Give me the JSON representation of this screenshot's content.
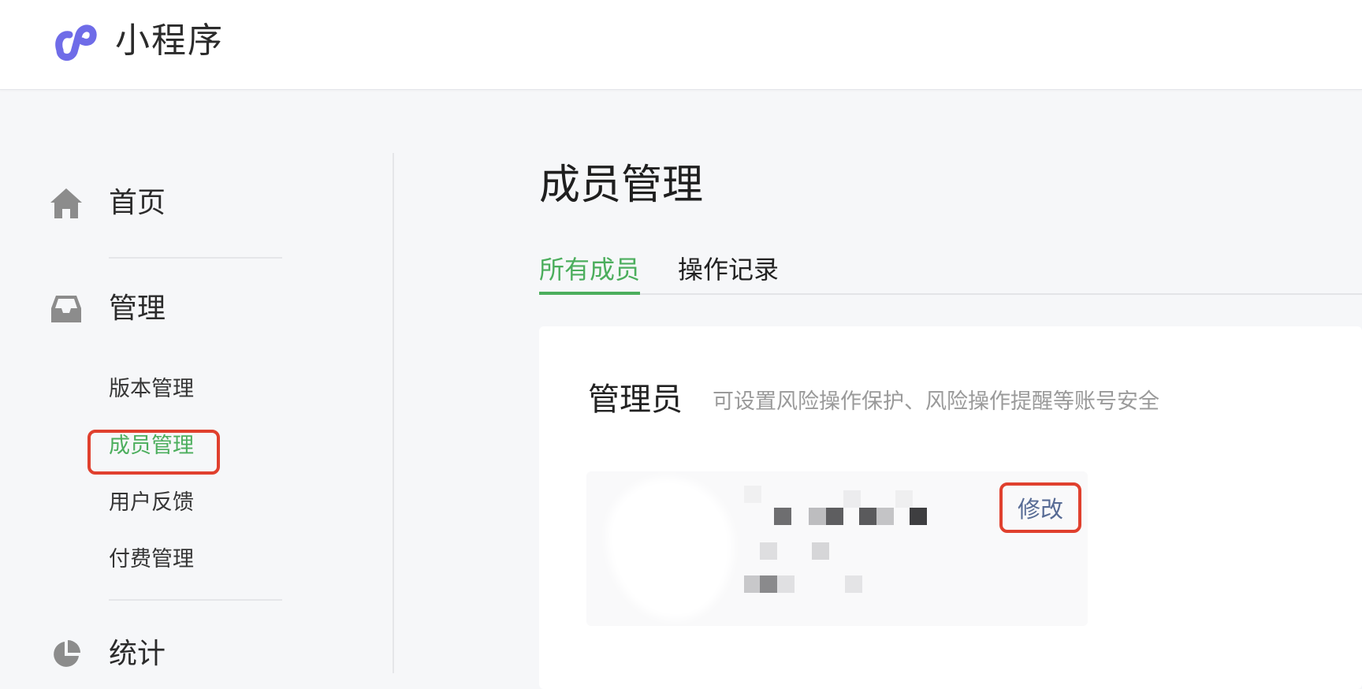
{
  "header": {
    "app_name": "小程序",
    "logo_icon": "mini-program-logo-icon",
    "logo_color": "#6f6ce8"
  },
  "sidebar": {
    "sections": [
      {
        "label": "首页",
        "icon": "home-icon"
      },
      {
        "label": "管理",
        "icon": "inbox-icon"
      },
      {
        "label": "统计",
        "icon": "pie-chart-icon"
      }
    ],
    "sub_items": [
      {
        "label": "版本管理",
        "active": false
      },
      {
        "label": "成员管理",
        "active": true
      },
      {
        "label": "用户反馈",
        "active": false
      },
      {
        "label": "付费管理",
        "active": false
      }
    ]
  },
  "main": {
    "page_title": "成员管理",
    "tabs": [
      {
        "label": "所有成员",
        "active": true
      },
      {
        "label": "操作记录",
        "active": false
      }
    ],
    "admin_section": {
      "title": "管理员",
      "description": "可设置风险操作保护、风险操作提醒等账号安全",
      "modify_label": "修改"
    }
  },
  "colors": {
    "accent_green": "#4cae5d",
    "link_blue": "#576b95",
    "highlight_red": "#e0402e"
  }
}
